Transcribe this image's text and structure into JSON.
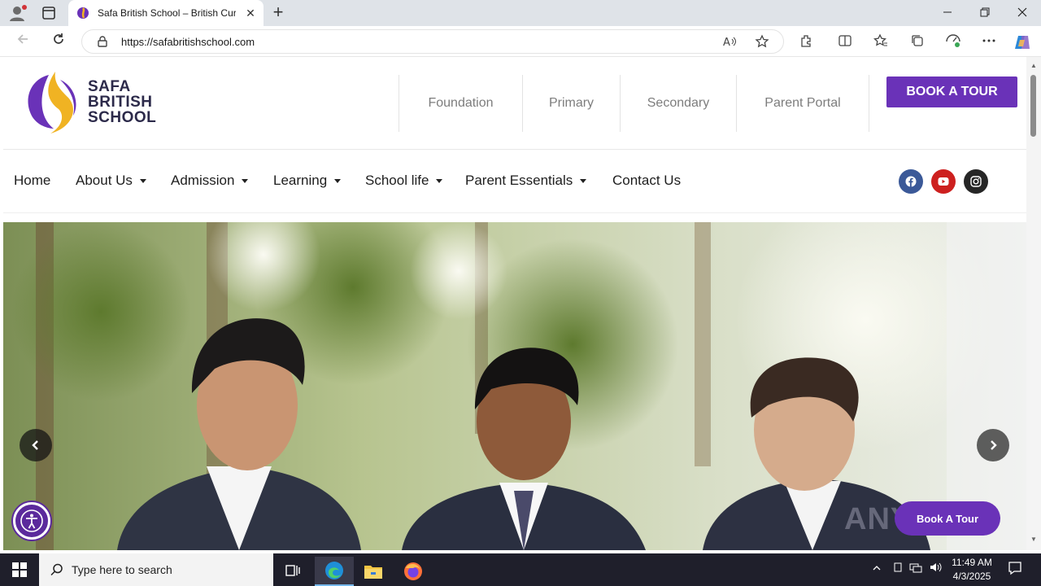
{
  "browser": {
    "tab_title": "Safa British School – British Curri",
    "url": "https://safabritishschool.com",
    "new_tab_label": "+",
    "close_label": "✕"
  },
  "site": {
    "logo_lines": [
      "SAFA",
      "BRITISH",
      "SCHOOL"
    ],
    "school_links": [
      "Foundation",
      "Primary",
      "Secondary",
      "Parent Portal"
    ],
    "book_tour": "BOOK A TOUR",
    "nav": [
      {
        "label": "Home",
        "dropdown": false
      },
      {
        "label": "About Us",
        "dropdown": true
      },
      {
        "label": "Admission",
        "dropdown": true
      },
      {
        "label": "Learning",
        "dropdown": true
      },
      {
        "label": "School life",
        "dropdown": true
      },
      {
        "label": "Parent Essentials",
        "dropdown": true
      },
      {
        "label": "Contact Us",
        "dropdown": false
      }
    ],
    "social": [
      {
        "name": "facebook-icon",
        "color": "#3b5998"
      },
      {
        "name": "youtube-icon",
        "color": "#cd201f"
      },
      {
        "name": "instagram-icon",
        "color": "#262626"
      }
    ],
    "floating_tour": "Book A Tour",
    "watermark": "ANY RUN"
  },
  "taskbar": {
    "search_placeholder": "Type here to search",
    "time": "11:49 AM",
    "date": "4/3/2025"
  },
  "colors": {
    "brand_purple": "#6a32b8",
    "brand_gold": "#f0b323"
  }
}
